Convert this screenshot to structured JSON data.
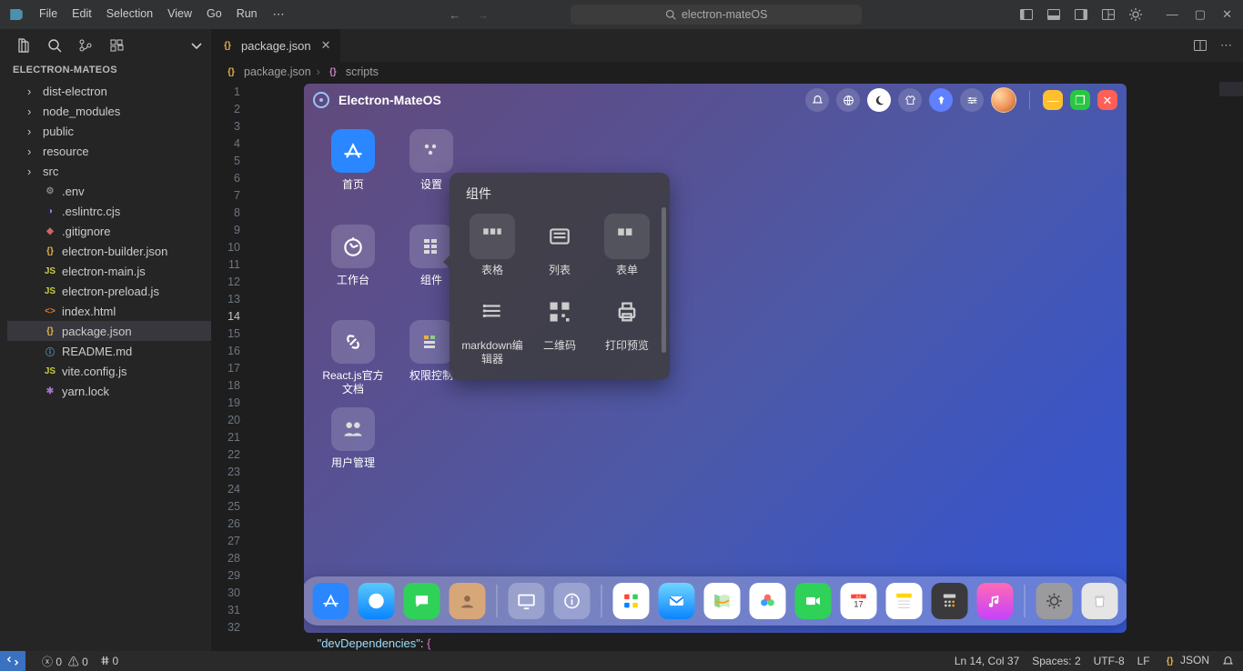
{
  "menu": {
    "items": [
      "File",
      "Edit",
      "Selection",
      "View",
      "Go",
      "Run"
    ]
  },
  "search": {
    "text": "electron-mateOS"
  },
  "explorer": {
    "title": "ELECTRON-MATEOS",
    "folders": [
      "dist-electron",
      "node_modules",
      "public",
      "resource",
      "src"
    ],
    "files": [
      {
        "name": ".env",
        "icon": "gear"
      },
      {
        "name": ".eslintrc.cjs",
        "icon": "eslint"
      },
      {
        "name": ".gitignore",
        "icon": "git"
      },
      {
        "name": "electron-builder.json",
        "icon": "json"
      },
      {
        "name": "electron-main.js",
        "icon": "js"
      },
      {
        "name": "electron-preload.js",
        "icon": "js"
      },
      {
        "name": "index.html",
        "icon": "html"
      },
      {
        "name": "package.json",
        "icon": "json",
        "active": true
      },
      {
        "name": "README.md",
        "icon": "info"
      },
      {
        "name": "vite.config.js",
        "icon": "js"
      },
      {
        "name": "yarn.lock",
        "icon": "lock"
      }
    ]
  },
  "tab": {
    "label": "package.json"
  },
  "crumbs": {
    "a": "package.json",
    "b": "scripts"
  },
  "code": {
    "line32": "\"devDependencies\"",
    "line32_after": ": {"
  },
  "gutter": {
    "lines": 32,
    "current": 14
  },
  "preview": {
    "title": "Electron-MateOS",
    "apps": [
      {
        "label": "首页",
        "variant": "blue",
        "glyph": "A"
      },
      {
        "label": "设置",
        "variant": "",
        "glyph": "⚙"
      },
      {
        "label": "工作台",
        "variant": "",
        "glyph": "⏱"
      },
      {
        "label": "组件",
        "variant": "",
        "glyph": "▦"
      },
      {
        "label": "React.js官方文档",
        "variant": "",
        "glyph": "🔗"
      },
      {
        "label": "权限控制",
        "variant": "",
        "glyph": "▤"
      },
      {
        "label": "用户管理",
        "variant": "",
        "glyph": "👥"
      }
    ],
    "popup": {
      "title": "组件",
      "items": [
        {
          "label": "表格"
        },
        {
          "label": "列表"
        },
        {
          "label": "表单"
        },
        {
          "label": "markdown编辑器"
        },
        {
          "label": "二维码"
        },
        {
          "label": "打印预览"
        }
      ]
    }
  },
  "status": {
    "errors": "0",
    "warnings": "0",
    "ports": "0",
    "lncol": "Ln 14, Col 37",
    "spaces": "Spaces: 2",
    "encoding": "UTF-8",
    "eol": "LF",
    "lang": "JSON"
  }
}
